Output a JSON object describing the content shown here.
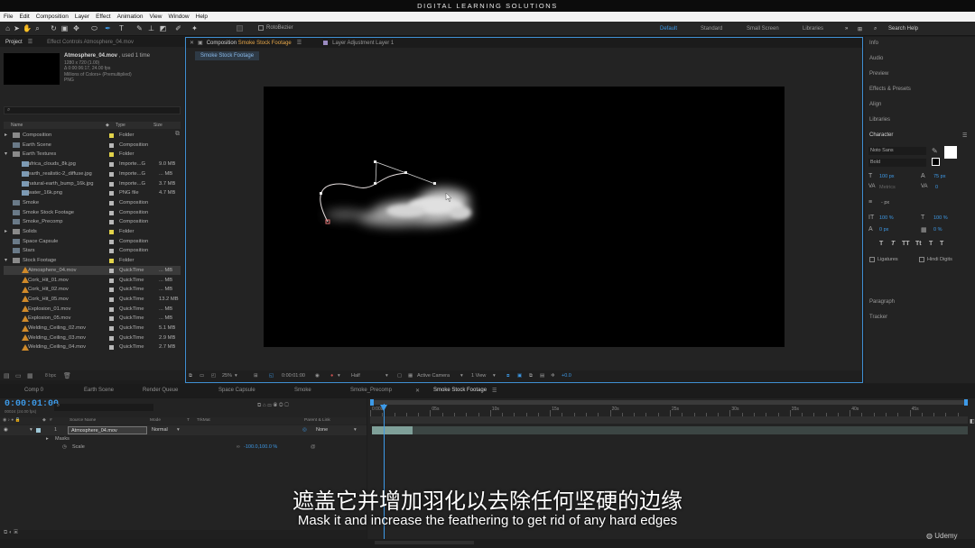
{
  "title_bar": "DIGITAL LEARNING SOLUTIONS",
  "menu": [
    "File",
    "Edit",
    "Composition",
    "Layer",
    "Effect",
    "Animation",
    "View",
    "Window",
    "Help"
  ],
  "toolbar": {
    "rotobezier": "RotoBezier"
  },
  "workspaces": [
    "Default",
    "Standard",
    "Small Screen",
    "Libraries"
  ],
  "search_help": "Search Help",
  "project": {
    "tab": "Project",
    "effect_controls_tab": "Effect Controls Atmosphere_04.mov",
    "preview_name": "Atmosphere_04.mov",
    "used": ", used 1 time",
    "info_lines": [
      "1280 x 720 (1.00)",
      "Δ 0:00:06:17, 24.00 fps",
      "Millions of Colors+ (Premultiplied)",
      "PNG"
    ],
    "col_name": "Name",
    "col_type": "Type",
    "col_size": "Size",
    "bpc": "8 bpc",
    "rows": [
      {
        "name": "Composition",
        "type": "Folder",
        "size": "",
        "kind": "folder",
        "indent": 0,
        "color": "#e2d34a"
      },
      {
        "name": "Earth Scene",
        "type": "Composition",
        "size": "",
        "kind": "comp",
        "indent": 0,
        "color": "#b8b8b8"
      },
      {
        "name": "Earth Textures",
        "type": "Folder",
        "size": "",
        "kind": "folder",
        "indent": 0,
        "color": "#e2d34a"
      },
      {
        "name": "africa_clouds_8k.jpg",
        "type": "Importe...G",
        "size": "9.0 MB",
        "kind": "img",
        "indent": 1,
        "color": "#b8b8b8"
      },
      {
        "name": "earth_realistic-2_diffuse.jpg",
        "type": "Importe...G",
        "size": "... MB",
        "kind": "img",
        "indent": 1,
        "color": "#b8b8b8"
      },
      {
        "name": "natural-earth_bump_16k.jpg",
        "type": "Importe...G",
        "size": "3.7 MB",
        "kind": "img",
        "indent": 1,
        "color": "#b8b8b8"
      },
      {
        "name": "water_16k.png",
        "type": "PNG file",
        "size": "4.7 MB",
        "kind": "img",
        "indent": 1,
        "color": "#b8b8b8"
      },
      {
        "name": "Smoke",
        "type": "Composition",
        "size": "",
        "kind": "comp",
        "indent": 0,
        "color": "#b8b8b8"
      },
      {
        "name": "Smoke Stock Footage",
        "type": "Composition",
        "size": "",
        "kind": "comp",
        "indent": 0,
        "color": "#b8b8b8"
      },
      {
        "name": "Smoke_Precomp",
        "type": "Composition",
        "size": "",
        "kind": "comp",
        "indent": 0,
        "color": "#b8b8b8"
      },
      {
        "name": "Solids",
        "type": "Folder",
        "size": "",
        "kind": "folder",
        "indent": 0,
        "color": "#e2d34a"
      },
      {
        "name": "Space Capsule",
        "type": "Composition",
        "size": "",
        "kind": "comp",
        "indent": 0,
        "color": "#b8b8b8"
      },
      {
        "name": "Stars",
        "type": "Composition",
        "size": "",
        "kind": "comp",
        "indent": 0,
        "color": "#b8b8b8"
      },
      {
        "name": "Stock Footage",
        "type": "Folder",
        "size": "",
        "kind": "folder",
        "indent": 0,
        "color": "#e2d34a"
      },
      {
        "name": "Atmosphere_04.mov",
        "type": "QuickTime",
        "size": "... MB",
        "kind": "qt",
        "indent": 1,
        "color": "#b8b8b8"
      },
      {
        "name": "Cork_Hit_01.mov",
        "type": "QuickTime",
        "size": "... MB",
        "kind": "qt",
        "indent": 1,
        "color": "#b8b8b8"
      },
      {
        "name": "Cork_Hit_02.mov",
        "type": "QuickTime",
        "size": "... MB",
        "kind": "qt",
        "indent": 1,
        "color": "#b8b8b8"
      },
      {
        "name": "Cork_Hit_05.mov",
        "type": "QuickTime",
        "size": "13.2 MB",
        "kind": "qt",
        "indent": 1,
        "color": "#b8b8b8"
      },
      {
        "name": "Explosion_01.mov",
        "type": "QuickTime",
        "size": "... MB",
        "kind": "qt",
        "indent": 1,
        "color": "#b8b8b8"
      },
      {
        "name": "Explosion_05.mov",
        "type": "QuickTime",
        "size": "... MB",
        "kind": "qt",
        "indent": 1,
        "color": "#b8b8b8"
      },
      {
        "name": "Welding_Ceiling_02.mov",
        "type": "QuickTime",
        "size": "5.1 MB",
        "kind": "qt",
        "indent": 1,
        "color": "#b8b8b8"
      },
      {
        "name": "Welding_Ceiling_03.mov",
        "type": "QuickTime",
        "size": "2.9 MB",
        "kind": "qt",
        "indent": 1,
        "color": "#b8b8b8"
      },
      {
        "name": "Welding_Ceiling_04.mov",
        "type": "QuickTime",
        "size": "2.7 MB",
        "kind": "qt",
        "indent": 1,
        "color": "#b8b8b8"
      }
    ]
  },
  "comp_panel": {
    "tab_prefix": "Composition",
    "tab_name": "Smoke Stock Footage",
    "layer_tab": "Layer  Adjustment Layer 1",
    "sub_tab": "Smoke Stock Footage",
    "zoom": "25%",
    "timecode": "0:00:01:00",
    "resolution": "Half",
    "camera": "Active Camera",
    "views": "1 View",
    "exposure": "+0.0"
  },
  "right_panel": {
    "items_top": [
      "Info",
      "Audio",
      "Preview",
      "Effects & Presets",
      "Align",
      "Libraries"
    ],
    "character": "Character",
    "font": "Noto Sans",
    "style": "Bold",
    "size": "100 px",
    "leading": "75 px",
    "kerning": "Metrics",
    "tracking": "0",
    "stroke": "- px",
    "vscale": "100 %",
    "hscale": "100 %",
    "baseline": "0 px",
    "tsume": "0 %",
    "type_buttons": [
      "T",
      "T",
      "TT",
      "Tt",
      "T",
      "T"
    ],
    "ligatures": "Ligatures",
    "hindi_digits": "Hindi Digits",
    "paragraph": "Paragraph",
    "tracker": "Tracker"
  },
  "timeline": {
    "tabs": [
      "Comp 0",
      "Earth Scene",
      "Render Queue",
      "Space Capsule",
      "Smoke",
      "Smoke_Precomp",
      "Smoke Stock Footage"
    ],
    "timecode": "0:00:01:00",
    "frames": "00024 (24.00 fps)",
    "col_source": "Source Name",
    "col_mode": "Mode",
    "col_t": "T",
    "col_trkmat": "TrkMat",
    "col_parent": "Parent & Link",
    "layer_num": "1",
    "layer_name": "Atmosphere_04.mov",
    "layer_mode": "Normal",
    "layer_parent": "None",
    "masks": "Masks",
    "scale_label": "Scale",
    "scale_value": "-100.0,100.0 %",
    "ruler": [
      "0:00s",
      "05s",
      "10s",
      "15s",
      "20s",
      "25s",
      "30s",
      "35s",
      "40s",
      "45s"
    ]
  },
  "subtitle_cn": "遮盖它并增加羽化以去除任何坚硬的边缘",
  "subtitle_en": "Mask it and increase the feathering to get rid of any hard edges",
  "watermark": "Udemy",
  "colors": {
    "accent": "#3d9ae8",
    "timecode": "#3d9ae8",
    "viewer_border": "#3f8fd2"
  }
}
